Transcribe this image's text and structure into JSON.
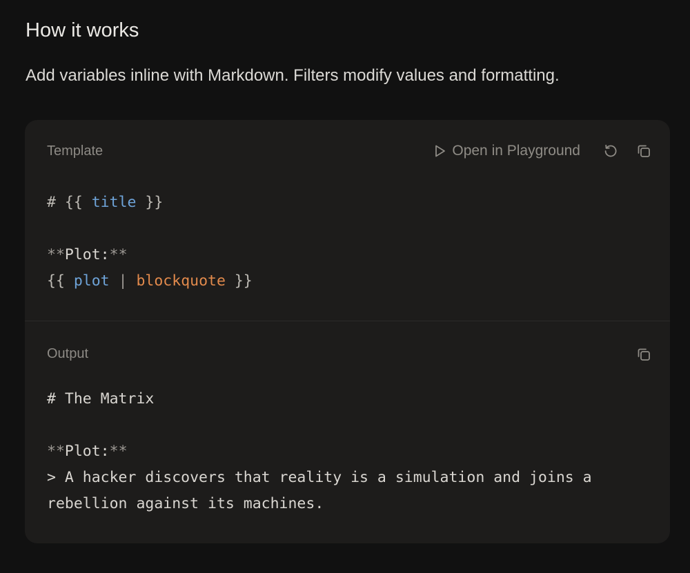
{
  "heading": "How it works",
  "description": "Add variables inline with Markdown. Filters modify values and formatting.",
  "template_panel": {
    "label": "Template",
    "open_playground_label": "Open in Playground",
    "lines": {
      "l1_hash": "# ",
      "l1_open": "{{ ",
      "l1_var": "title",
      "l1_close": " }}",
      "l3_star_open": "**",
      "l3_text": "Plot:",
      "l3_star_close": "**",
      "l4_open": "{{ ",
      "l4_var": "plot",
      "l4_pipe": " | ",
      "l4_filter": "blockquote",
      "l4_close": " }}"
    }
  },
  "output_panel": {
    "label": "Output",
    "lines": {
      "l1": "# The Matrix",
      "l3_star_open": "**",
      "l3_text": "Plot:",
      "l3_star_close": "**",
      "l4": "> A hacker discovers that reality is a simulation and joins a",
      "l5": "rebellion against its machines."
    }
  },
  "icons": {
    "play": "play-icon",
    "reset": "reset-icon",
    "copy": "copy-icon"
  },
  "colors": {
    "background": "#111111",
    "card": "#1d1c1b",
    "variable": "#6ea3d8",
    "filter": "#e28a4c"
  }
}
